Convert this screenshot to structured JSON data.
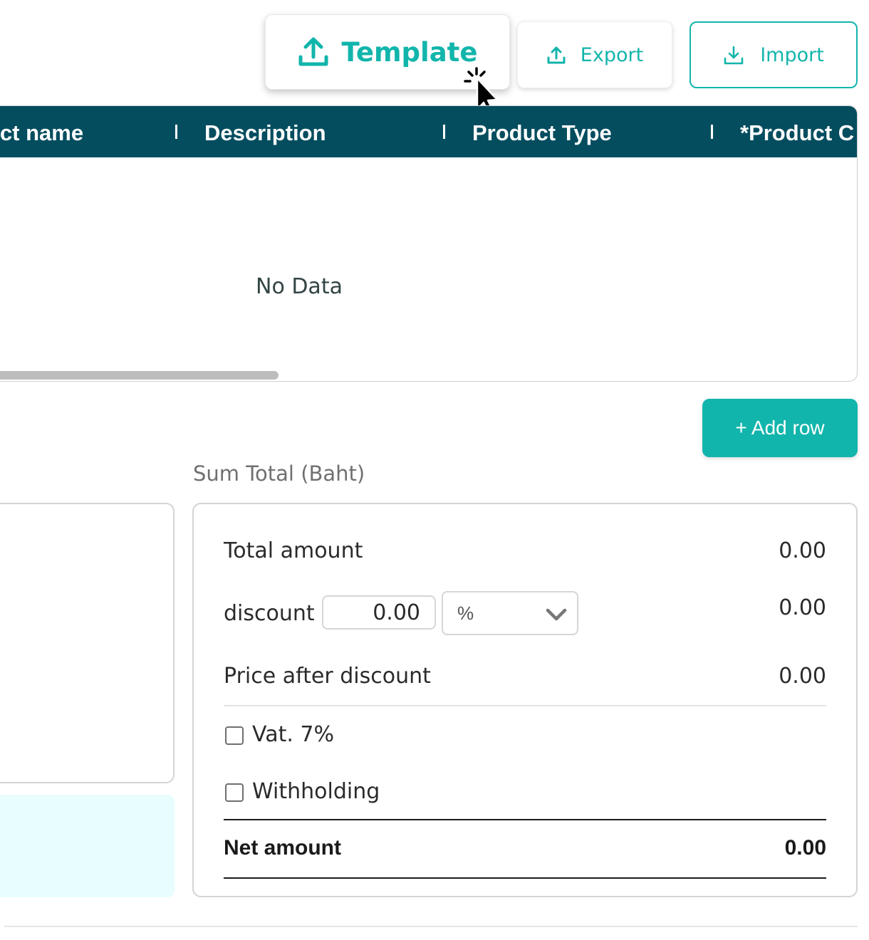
{
  "toolbar": {
    "template_label": "Template",
    "export_label": "Export",
    "import_label": "Import",
    "template_icon": "upload-icon",
    "export_icon": "upload-icon",
    "import_icon": "download-icon"
  },
  "table": {
    "columns": [
      "uct name",
      "Description",
      "Product Type",
      "*Product C"
    ],
    "empty_text": "No Data"
  },
  "actions": {
    "add_row_label": "+ Add row"
  },
  "summary": {
    "title": "Sum Total (Baht)",
    "total_amount_label": "Total amount",
    "total_amount_value": "0.00",
    "discount_label": "discount",
    "discount_input_value": "0.00",
    "discount_type_selected": "%",
    "discount_value": "0.00",
    "price_after_discount_label": "Price after discount",
    "price_after_discount_value": "0.00",
    "vat_label": "Vat. 7%",
    "vat_checked": false,
    "withholding_label": "Withholding",
    "withholding_checked": false,
    "net_amount_label": "Net amount",
    "net_amount_value": "0.00"
  },
  "colors": {
    "accent": "#12b5ab",
    "table_header": "#034d5f",
    "note_background": "#e8fdfd"
  }
}
